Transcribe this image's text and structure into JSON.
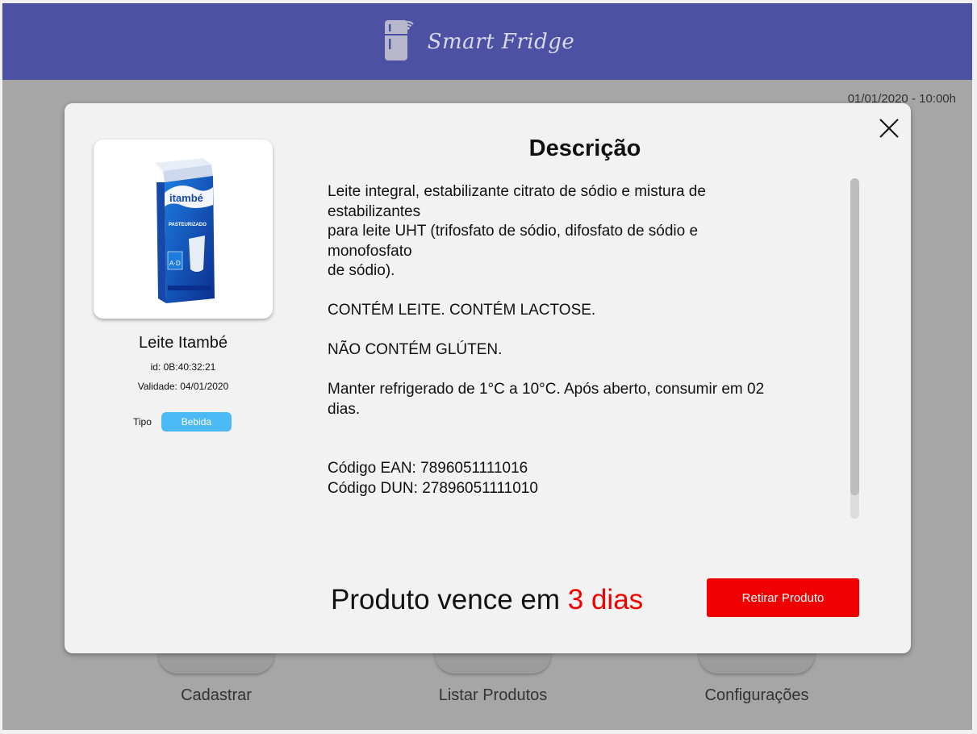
{
  "header": {
    "app_title": "Smart Fridge",
    "logo_icon": "fridge-wifi-icon",
    "color": "#4c51a4"
  },
  "datetime": "01/01/2020 - 10:00h",
  "bottom_nav": {
    "items": [
      {
        "label": "Cadastrar"
      },
      {
        "label": "Listar Produtos"
      },
      {
        "label": "Configurações"
      }
    ]
  },
  "modal": {
    "close_icon": "close-icon",
    "product": {
      "image_icon": "milk-carton-image",
      "brand_text": "itambé",
      "carton_text": "PASTEURIZADO",
      "vitamin_text": "A·D",
      "name": "Leite Itambé",
      "id": "id: 0B:40:32:21",
      "validity": "Validade: 04/01/2020",
      "type_label": "Tipo",
      "type_value": "Bebida",
      "type_color": "#4ab9f5"
    },
    "description": {
      "title": "Descrição",
      "paragraph1": "Leite integral, estabilizante citrato de sódio e mistura de\nestabilizantes\npara leite UHT (trifosfato de sódio, difosfato de sódio e\nmonofosfato\nde sódio).",
      "paragraph2": "CONTÉM LEITE. CONTÉM LACTOSE.",
      "paragraph3": "NÃO CONTÉM GLÚTEN.",
      "paragraph4": "Manter refrigerado de 1°C a 10°C. Após aberto, consumir em 02\ndias.",
      "ean": "Código EAN: 7896051111016",
      "dun": "Código DUN: 27896051111010"
    },
    "expiry_prefix": "Produto vence em ",
    "expiry_days": "3 dias",
    "expiry_color": "#f20000",
    "remove_button": "Retirar Produto",
    "remove_color": "#f00000"
  }
}
